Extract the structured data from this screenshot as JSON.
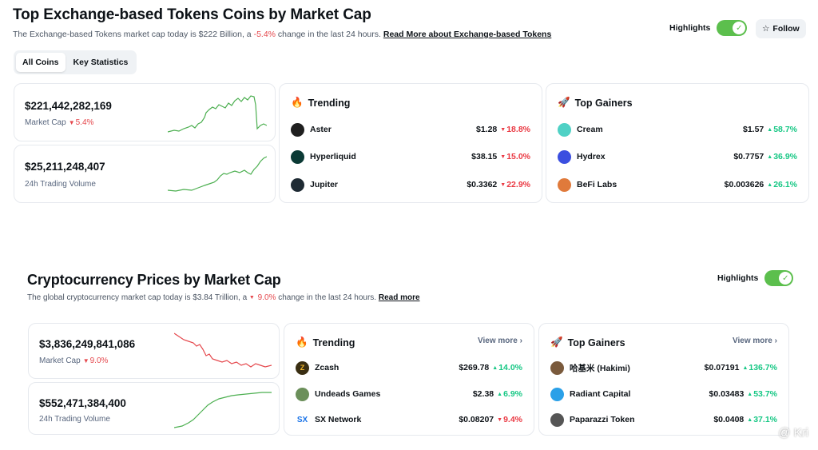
{
  "top": {
    "title": "Top Exchange-based Tokens Coins by Market Cap",
    "subtitle_prefix": "The Exchange-based Tokens market cap today is $222 Billion, a ",
    "subtitle_change": "-5.4%",
    "subtitle_suffix": " change in the last 24 hours. ",
    "read_more": "Read More about Exchange-based Tokens",
    "highlights_label": "Highlights",
    "follow_label": "Follow",
    "tabs": [
      {
        "label": "All Coins",
        "active": true
      },
      {
        "label": "Key Statistics",
        "active": false
      }
    ],
    "market_cap": {
      "value": "$221,442,282,169",
      "label": "Market Cap",
      "change": "5.4%"
    },
    "volume": {
      "value": "$25,211,248,407",
      "label": "24h Trading Volume"
    },
    "trending": {
      "title": "Trending",
      "rows": [
        {
          "name": "Aster",
          "price": "$1.28",
          "change": "18.8%",
          "dir": "down",
          "color": "#1f1f1f"
        },
        {
          "name": "Hyperliquid",
          "price": "$38.15",
          "change": "15.0%",
          "dir": "down",
          "color": "#0b3a35"
        },
        {
          "name": "Jupiter",
          "price": "$0.3362",
          "change": "22.9%",
          "dir": "down",
          "color": "#1e2a33"
        }
      ]
    },
    "gainers": {
      "title": "Top Gainers",
      "rows": [
        {
          "name": "Cream",
          "price": "$1.57",
          "change": "58.7%",
          "dir": "up",
          "color": "#4fd1c5"
        },
        {
          "name": "Hydrex",
          "price": "$0.7757",
          "change": "36.9%",
          "dir": "up",
          "color": "#3b4fe0"
        },
        {
          "name": "BeFi Labs",
          "price": "$0.003626",
          "change": "26.1%",
          "dir": "up",
          "color": "#e07a3b"
        }
      ]
    }
  },
  "crypto": {
    "title": "Cryptocurrency Prices by Market Cap",
    "subtitle_prefix": "The global cryptocurrency market cap today is $3.84 Trillion, a ",
    "subtitle_change": "9.0%",
    "subtitle_suffix": " change in the last 24 hours. ",
    "read_more": "Read more",
    "highlights_label": "Highlights",
    "market_cap": {
      "value": "$3,836,249,841,086",
      "label": "Market Cap",
      "change": "9.0%"
    },
    "volume": {
      "value": "$552,471,384,400",
      "label": "24h Trading Volume"
    },
    "trending": {
      "title": "Trending",
      "view_more": "View more",
      "rows": [
        {
          "name": "Zcash",
          "price": "$269.78",
          "change": "14.0%",
          "dir": "up",
          "color": "#3a2e12"
        },
        {
          "name": "Undeads Games",
          "price": "$2.38",
          "change": "6.9%",
          "dir": "up",
          "color": "#6b8f5a"
        },
        {
          "name": "SX Network",
          "price": "$0.08207",
          "change": "9.4%",
          "dir": "down",
          "color": "#1a73e8"
        }
      ]
    },
    "gainers": {
      "title": "Top Gainers",
      "view_more": "View more",
      "rows": [
        {
          "name": "哈基米 (Hakimi)",
          "price": "$0.07191",
          "change": "136.7%",
          "dir": "up",
          "color": "#7a5a3c"
        },
        {
          "name": "Radiant Capital",
          "price": "$0.03483",
          "change": "53.7%",
          "dir": "up",
          "color": "#2aa0e8"
        },
        {
          "name": "Paparazzi Token",
          "price": "$0.0408",
          "change": "37.1%",
          "dir": "up",
          "color": "#555555"
        }
      ]
    }
  },
  "watermark": "@ Kri",
  "colors": {
    "up": "#16c784",
    "down": "#ea3943",
    "toggle": "#5cbf4d",
    "spark_green": "#4caf50",
    "spark_red": "#e5484d"
  },
  "icons": {
    "trending": "fire-icon",
    "gainers": "rocket-icon",
    "follow": "star-icon"
  }
}
